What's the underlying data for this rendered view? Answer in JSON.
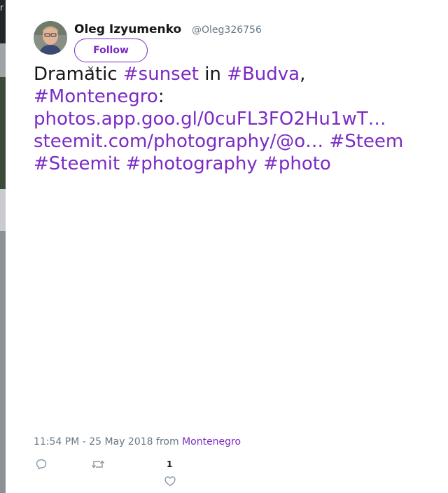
{
  "backdrop": {
    "edge_glyph": "r"
  },
  "author": {
    "name": "Oleg Izyumenko",
    "handle": "@Oleg326756",
    "follow_label": "Follow"
  },
  "tweet": {
    "word_dramatic": "Dramatic",
    "tag_sunset": "#sunset",
    "word_in": "in",
    "tag_budva": "#Budva",
    "comma": ",",
    "tag_montenegro": "#Montenegro",
    "colon": ":",
    "link_photos": "photos.app.goo.gl/0cuFL3FO2Hu1wT…",
    "link_steemit": "steemit.com/photography/@o…",
    "tag_steem": "#Steem",
    "tag_steemit": "#Steemit",
    "tag_photography": "#photography",
    "tag_photo": "#photo"
  },
  "meta": {
    "timestamp": "11:54 PM - 25 May 2018",
    "from": "from",
    "place": "Montenegro"
  },
  "actions": {
    "reply_icon": "reply-icon",
    "retweet_icon": "retweet-icon",
    "like_icon": "heart-icon",
    "like_count": "1"
  },
  "colors": {
    "accent": "#7b2bc4",
    "text": "#14171a",
    "muted": "#657786"
  }
}
